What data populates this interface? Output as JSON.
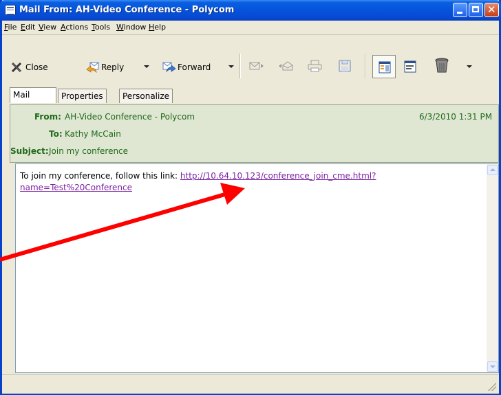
{
  "window": {
    "title": "Mail From: AH-Video Conference - Polycom"
  },
  "menu": [
    "File",
    "Edit",
    "View",
    "Actions",
    "Tools",
    "Window",
    "Help"
  ],
  "toolbar": {
    "close_label": "Close",
    "reply_label": "Reply",
    "forward_label": "Forward"
  },
  "tabs": [
    "Mail",
    "Properties",
    "Personalize"
  ],
  "header": {
    "from_label": "From:",
    "from_value": "AH-Video Conference - Polycom",
    "date": "6/3/2010 1:31 PM",
    "to_label": "To:",
    "to_value": "Kathy McCain",
    "subject_label": "Subject:",
    "subject_value": "Join my conference"
  },
  "body": {
    "text": "To join my conference, follow this link: ",
    "link_line1": "http://10.64.10.123/conference_join_cme.html?",
    "link_line2": "name=Test%20Conference"
  },
  "colors": {
    "title_bar": "#0553dc",
    "header_text": "#1f6a1b",
    "link": "#7b1fa2",
    "arrow": "#ff0000"
  },
  "icons": [
    "close-icon",
    "reply-icon",
    "forward-icon",
    "mail-icon",
    "mail-open-icon",
    "print-icon",
    "save-icon",
    "layout-view-icon",
    "preview-view-icon",
    "trash-icon"
  ]
}
